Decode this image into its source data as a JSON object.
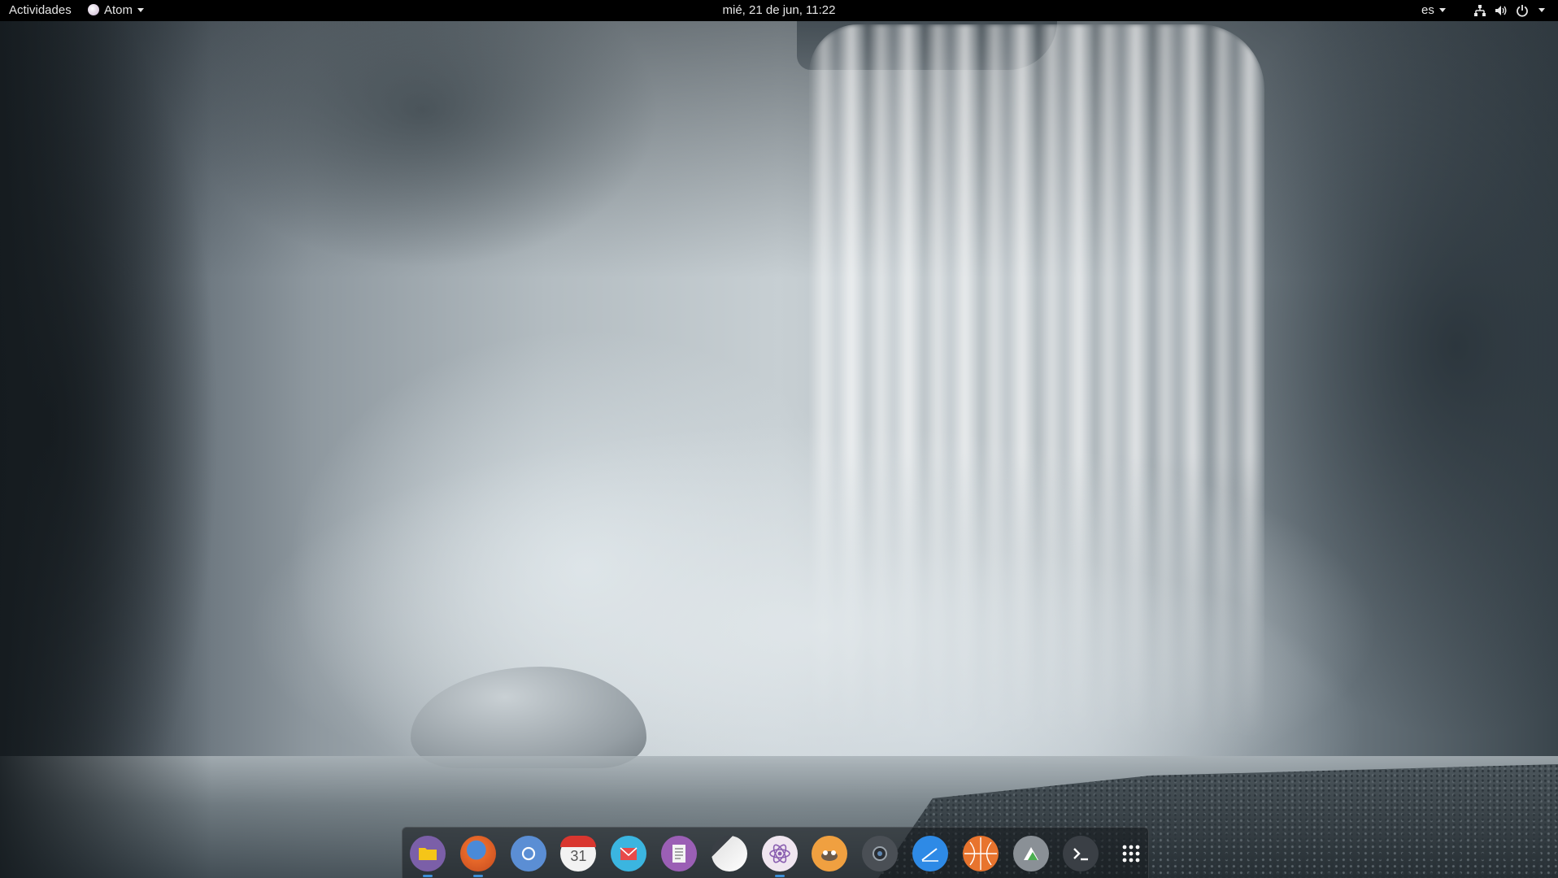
{
  "top_bar": {
    "activities_label": "Actividades",
    "app_menu_label": "Atom",
    "clock_text": "mié, 21 de jun, 11:22",
    "keyboard_layout": "es",
    "status_icons": [
      "network-icon",
      "volume-icon",
      "power-icon"
    ]
  },
  "dock": {
    "apps": [
      {
        "name": "files-icon",
        "color": "#7b5fa8",
        "running": true
      },
      {
        "name": "firefox-icon",
        "color": "#e8692a",
        "running": true
      },
      {
        "name": "chromium-icon",
        "color": "#5b8ed4",
        "running": false
      },
      {
        "name": "calendar-icon",
        "color": "#f2f2f2",
        "running": false,
        "text": "31"
      },
      {
        "name": "mail-icon",
        "color": "#3bb5e0",
        "running": false
      },
      {
        "name": "text-editor-icon",
        "color": "#9b5fb5",
        "running": false
      },
      {
        "name": "screenshot-icon",
        "color": "#e8e8e8",
        "running": false
      },
      {
        "name": "atom-icon",
        "color": "#f0e6f0",
        "running": true
      },
      {
        "name": "gimp-icon",
        "color": "#f0a040",
        "running": false
      },
      {
        "name": "camera-icon",
        "color": "#4a4f55",
        "running": false
      },
      {
        "name": "drawing-icon",
        "color": "#2e8ae6",
        "running": false
      },
      {
        "name": "basketball-icon",
        "color": "#e8742e",
        "running": false
      },
      {
        "name": "image-viewer-icon",
        "color": "#8a9096",
        "running": false
      },
      {
        "name": "terminal-icon",
        "color": "#3a3f45",
        "running": false
      },
      {
        "name": "show-apps-icon",
        "color": "#ffffff",
        "running": false
      }
    ]
  }
}
